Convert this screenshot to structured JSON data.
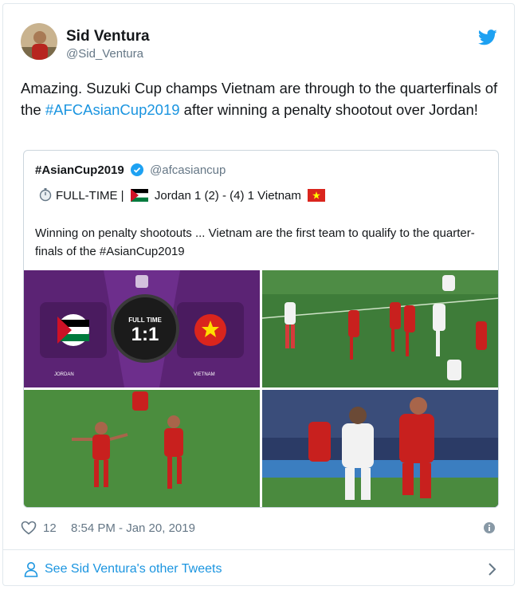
{
  "author": {
    "name": "Sid Ventura",
    "handle": "@Sid_Ventura"
  },
  "tweet": {
    "text_before": "Amazing. Suzuki Cup champs Vietnam are through to the quarterfinals of the ",
    "hashtag": "#AFCAsianCup2019",
    "text_after": " after winning a penalty shootout over Jordan!"
  },
  "quote": {
    "name": "#AsianCup2019",
    "handle": "@afcasiancup",
    "status_line_1": "FULL-TIME | ",
    "status_line_2": " Jordan 1 (2) - (4) 1 Vietnam ",
    "body": "Winning on penalty shootouts ... Vietnam are the first team to qualify to the quarter-finals of the #AsianCup2019",
    "scoreboard": {
      "label": "FULL TIME",
      "score": "1:1",
      "team_left": "JORDAN",
      "team_right": "VIETNAM"
    }
  },
  "footer": {
    "likes": "12",
    "timestamp": "8:54 PM - Jan 20, 2019"
  },
  "see_more": {
    "label": "See Sid Ventura's other Tweets"
  },
  "colors": {
    "link": "#1b95e0",
    "muted": "#657786",
    "text": "#14171a"
  },
  "icons": [
    "twitter-bird-icon",
    "verified-icon",
    "stopwatch-icon",
    "jordan-flag-icon",
    "vietnam-flag-icon",
    "heart-icon",
    "info-icon",
    "person-icon",
    "chevron-right-icon"
  ]
}
